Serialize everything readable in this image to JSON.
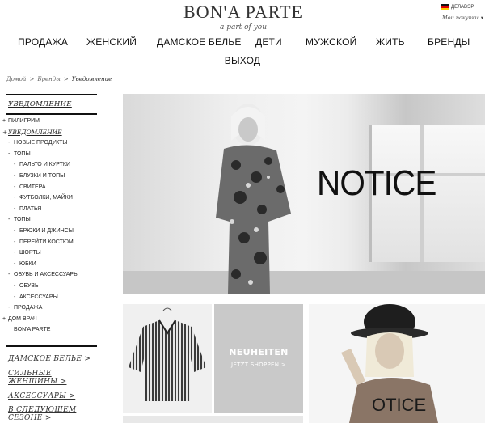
{
  "brand": {
    "name": "BON'A PARTE",
    "tagline": "a part of you"
  },
  "header": {
    "country": "ДЕЛАВЭР",
    "account_link": "Мои покупки"
  },
  "nav": {
    "items": [
      "ПРОДАЖА",
      "ЖЕНСКИЙ",
      "ДАМСКОЕ БЕЛЬЕ",
      "ДЕТИ",
      "МУЖСКОЙ",
      "ЖИТЬ",
      "БРЕНДЫ",
      "ВЫХОД"
    ]
  },
  "breadcrumb": [
    "Домой",
    "Бренды",
    "Уведомление"
  ],
  "sidebar": {
    "title": "УВЕДОМЛЕНИЕ",
    "items": [
      {
        "label": "ПИЛИГРИМ",
        "prefix": "+"
      },
      {
        "label": "УВЕДОМЛЕНИЕ",
        "prefix": "+"
      },
      {
        "label": "НОВЫЕ ПРОДУКТЫ",
        "prefix": "-"
      },
      {
        "label": "ТОПЫ",
        "prefix": "-"
      },
      {
        "label": "ПАЛЬТО И КУРТКИ",
        "prefix": "-"
      },
      {
        "label": "БЛУЗКИ И ТОПЫ",
        "prefix": "-"
      },
      {
        "label": "СВИТЕРА",
        "prefix": "-"
      },
      {
        "label": "ФУТБОЛКИ, МАЙКИ",
        "prefix": "-"
      },
      {
        "label": "ПЛАТЬЯ",
        "prefix": "-"
      },
      {
        "label": "ТОПЫ",
        "prefix": "-"
      },
      {
        "label": "БРЮКИ И ДЖИНСЫ",
        "prefix": "-"
      },
      {
        "label": "ПЕРЕЙТИ КОСТЮМ",
        "prefix": "-"
      },
      {
        "label": "ШОРТЫ",
        "prefix": "-"
      },
      {
        "label": "ЮБКИ",
        "prefix": "-"
      },
      {
        "label": "ОБУВЬ И АКСЕССУАРЫ",
        "prefix": "-"
      },
      {
        "label": "ОБУВЬ",
        "prefix": "-"
      },
      {
        "label": "АКСЕССУАРЫ",
        "prefix": "-"
      },
      {
        "label": "ПРОДАЖА",
        "prefix": "-"
      },
      {
        "label": "ДОМ ВРАЧ",
        "prefix": "+"
      },
      {
        "label": "BON'A PARTE",
        "prefix": ""
      }
    ],
    "promos": [
      "ДАМСКОЕ БЕЛЬЕ >",
      "СИЛЬНЫЕ ЖЕНЩИНЫ >",
      "АКСЕССУАРЫ >",
      "В СЛЕДУЮЩЕМ СЕЗОНЕ >"
    ]
  },
  "hero": {
    "headline": "NOTICE"
  },
  "tiles": {
    "news_title": "NEUHEITEN",
    "news_cta": "JETZT SHOPPEN >",
    "shirt_print": "OTICE"
  }
}
